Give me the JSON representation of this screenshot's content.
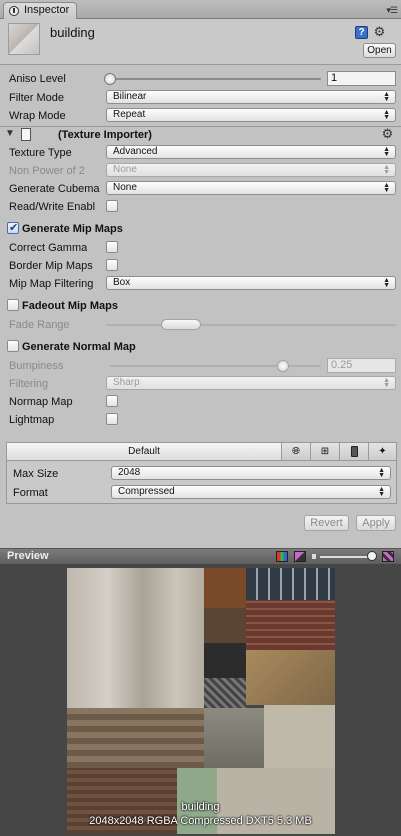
{
  "tab": {
    "label": "Inspector"
  },
  "header": {
    "asset_name": "building",
    "help_glyph": "?",
    "open_label": "Open"
  },
  "settings": {
    "aniso_level": {
      "label": "Aniso Level",
      "value": "1",
      "slider_fraction": 0.0
    },
    "filter_mode": {
      "label": "Filter Mode",
      "value": "Bilinear"
    },
    "wrap_mode": {
      "label": "Wrap Mode",
      "value": "Repeat"
    }
  },
  "importer": {
    "title": "(Texture Importer)",
    "texture_type": {
      "label": "Texture Type",
      "value": "Advanced"
    },
    "non_power_of_2": {
      "label": "Non Power of 2",
      "value": "None"
    },
    "generate_cubemap": {
      "label": "Generate Cubema",
      "value": "None"
    },
    "read_write": {
      "label": "Read/Write Enabl",
      "checked": false
    },
    "generate_mip_maps": {
      "label": "Generate Mip Maps",
      "checked": true
    },
    "correct_gamma": {
      "label": "Correct Gamma",
      "checked": false
    },
    "border_mip_maps": {
      "label": "Border Mip Maps",
      "checked": false
    },
    "mip_map_filtering": {
      "label": "Mip Map Filtering",
      "value": "Box"
    },
    "fadeout_mip_maps": {
      "label": "Fadeout Mip Maps",
      "checked": false
    },
    "fade_range": {
      "label": "Fade Range"
    },
    "generate_normal_map": {
      "label": "Generate Normal Map",
      "checked": false
    },
    "bumpiness": {
      "label": "Bumpiness",
      "value": "0.25"
    },
    "filtering": {
      "label": "Filtering",
      "value": "Sharp"
    },
    "normal_map": {
      "label": "Normap Map",
      "checked": false
    },
    "lightmap": {
      "label": "Lightmap",
      "checked": false
    }
  },
  "platform": {
    "default_tab": "Default",
    "max_size": {
      "label": "Max Size",
      "value": "2048"
    },
    "format": {
      "label": "Format",
      "value": "Compressed"
    }
  },
  "actions": {
    "revert": "Revert",
    "apply": "Apply"
  },
  "preview": {
    "title": "Preview",
    "caption_name": "building",
    "caption_info": "2048x2048  RGBA Compressed DXT5   5.3 MB"
  },
  "icons": {
    "tab": "info-icon",
    "menu": "tab-menu-icon",
    "help": "help-icon",
    "gear": "gear-icon",
    "foldout": "foldout-arrow-icon",
    "document": "document-icon",
    "dropdown": "dropdown-arrows-icon",
    "web": "globe-icon",
    "standalone": "windows-icon",
    "iphone": "phone-icon",
    "android": "android-icon",
    "rgb": "rgb-channel-icon",
    "alpha": "alpha-channel-icon"
  },
  "colors": {
    "checkbox_check": "#20406f",
    "help_icon": "#3a70c7",
    "preview_bg": "#464646"
  }
}
